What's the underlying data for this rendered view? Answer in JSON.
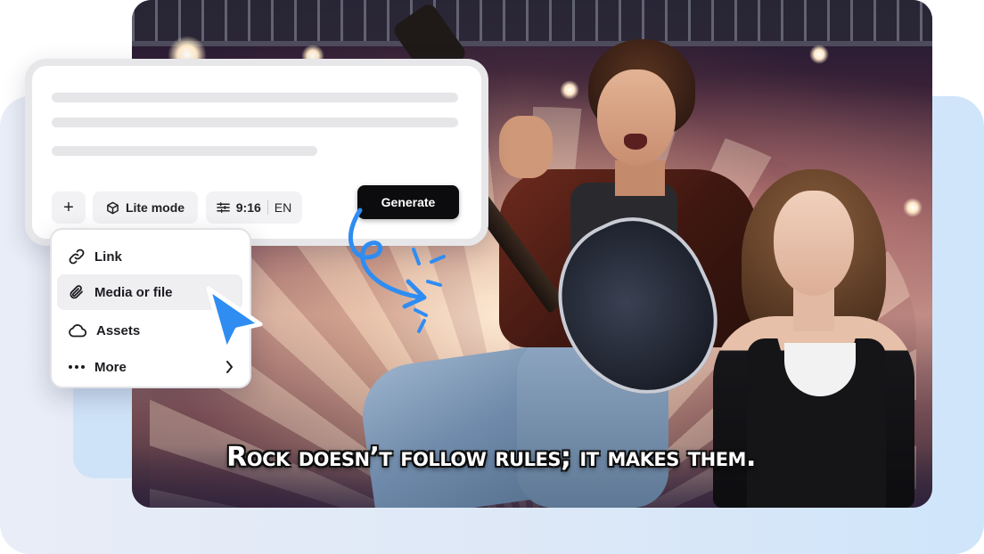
{
  "prompt_box": {
    "toolbar": {
      "add_label": "+",
      "lite_mode_label": "Lite mode",
      "aspect_ratio": "9:16",
      "language": "EN",
      "generate_label": "Generate"
    }
  },
  "menu": {
    "items": [
      {
        "label": "Link",
        "icon": "link-icon"
      },
      {
        "label": "Media or file",
        "icon": "paperclip-icon",
        "active": true
      },
      {
        "label": "Assets",
        "icon": "cloud-icon"
      },
      {
        "label": "More",
        "icon": "more-dots-icon",
        "has_submenu": true
      }
    ]
  },
  "video": {
    "caption": "Rock doesn’t follow rules; it makes them."
  },
  "colors": {
    "accent_blue": "#2f8df2",
    "generate_bg": "#0c0c0e",
    "panel_bg": "#dde8f7"
  }
}
